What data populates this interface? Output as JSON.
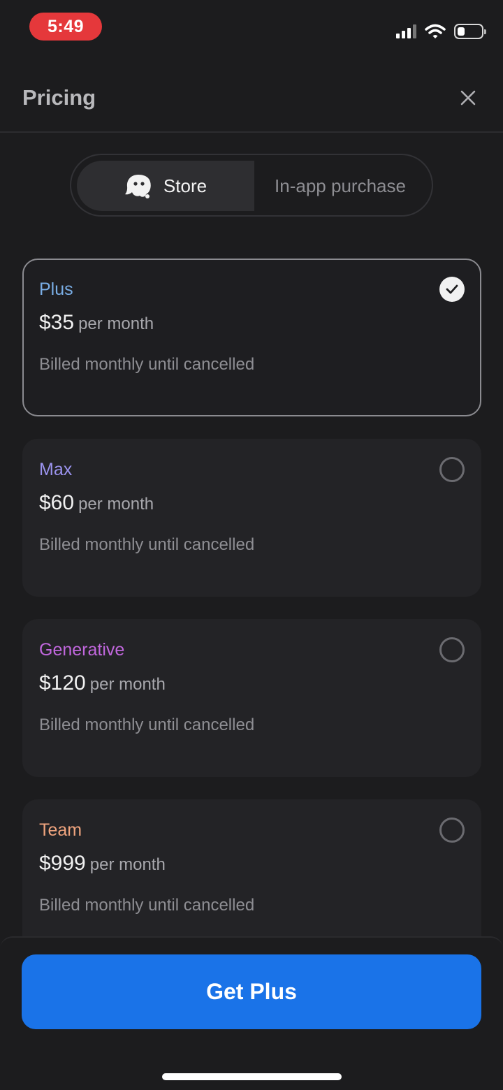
{
  "status_bar": {
    "time": "5:49",
    "icons": [
      "cellular-signal-icon",
      "wifi-icon",
      "battery-icon"
    ],
    "battery_level": 0.3
  },
  "header": {
    "title": "Pricing",
    "close_icon": "close-icon"
  },
  "segmented_control": {
    "tabs": [
      {
        "label": "Store",
        "icon": "ghost-mascot-icon",
        "active": true
      },
      {
        "label": "In-app purchase",
        "active": false
      }
    ]
  },
  "plans": [
    {
      "name": "Plus",
      "price": "$35",
      "unit": "per month",
      "billing": "Billed monthly until cancelled",
      "selected": true,
      "color": "#7aaee6"
    },
    {
      "name": "Max",
      "price": "$60",
      "unit": "per month",
      "billing": "Billed monthly until cancelled",
      "selected": false,
      "color": "#9b93ee"
    },
    {
      "name": "Generative",
      "price": "$120",
      "unit": "per month",
      "billing": "Billed monthly until cancelled",
      "selected": false,
      "color": "#c167dd"
    },
    {
      "name": "Team",
      "price": "$999",
      "unit": "per month",
      "billing": "Billed monthly until cancelled",
      "selected": false,
      "color": "#f0a47e"
    }
  ],
  "cta": {
    "label": "Get Plus",
    "color": "#1a73e8"
  }
}
